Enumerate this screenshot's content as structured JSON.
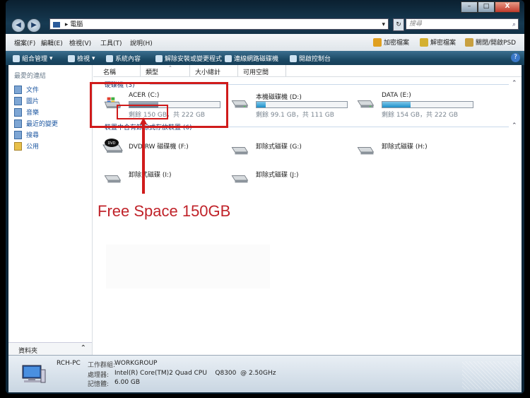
{
  "window": {
    "minimize": "–",
    "maximize": "□",
    "close": "X"
  },
  "address": {
    "path": "電腦",
    "separator": "▸",
    "search_placeholder": "搜尋"
  },
  "menu": {
    "items": [
      "檔案(F)",
      "編輯(E)",
      "檢視(V)",
      "工具(T)",
      "說明(H)"
    ],
    "actions": [
      {
        "label": "加密檔案",
        "color": "#e0a020"
      },
      {
        "label": "解密檔案",
        "color": "#d4b030"
      },
      {
        "label": "關閉/開啟PSD",
        "color": "#c8a040"
      }
    ]
  },
  "toolbar": {
    "items": [
      "組合管理",
      "檢視",
      "系統內容",
      "解除安裝或變更程式",
      "連線網路磁碟機",
      "開啟控制台"
    ],
    "help": "?"
  },
  "sidebar": {
    "heading": "最愛的連結",
    "items": [
      "文件",
      "圖片",
      "音樂",
      "最近的變更",
      "搜尋",
      "公用"
    ],
    "footer": "資料夾",
    "footer_chevron": "⌃"
  },
  "columns": [
    "名稱",
    "類型",
    "大小總計",
    "可用空間"
  ],
  "groups": [
    {
      "label": "硬碟機 (3)"
    },
    {
      "label": "裝置中含有卸除式存放裝置 (6)"
    }
  ],
  "hard_drives": [
    {
      "name": "ACER (C:)",
      "free": "剩餘 150 GB，共 222 GB",
      "used_fraction": 0.32
    },
    {
      "name": "本機磁碟機 (D:)",
      "free": "剩餘 99.1 GB，共 111 GB",
      "used_fraction": 0.1
    },
    {
      "name": "DATA (E:)",
      "free": "剩餘 154 GB，共 222 GB",
      "used_fraction": 0.31
    }
  ],
  "removable": [
    {
      "name": "DVD RW 磁碟機 (F:)"
    },
    {
      "name": "卸除式磁碟 (G:)"
    },
    {
      "name": "卸除式磁碟 (H:)"
    },
    {
      "name": "卸除式磁碟 (I:)"
    },
    {
      "name": "卸除式磁碟 (J:)"
    }
  ],
  "annotation": {
    "text": "Free Space 150GB",
    "color": "#c0232a"
  },
  "details": {
    "computer_name": "RCH-PC",
    "rows": [
      {
        "label": "工作群組:",
        "value": "WORKGROUP"
      },
      {
        "label": "處理器:",
        "value": "Intel(R) Core(TM)2 Quad CPU    Q8300  @ 2.50GHz"
      },
      {
        "label": "記憶體:",
        "value": "6.00 GB"
      }
    ]
  }
}
